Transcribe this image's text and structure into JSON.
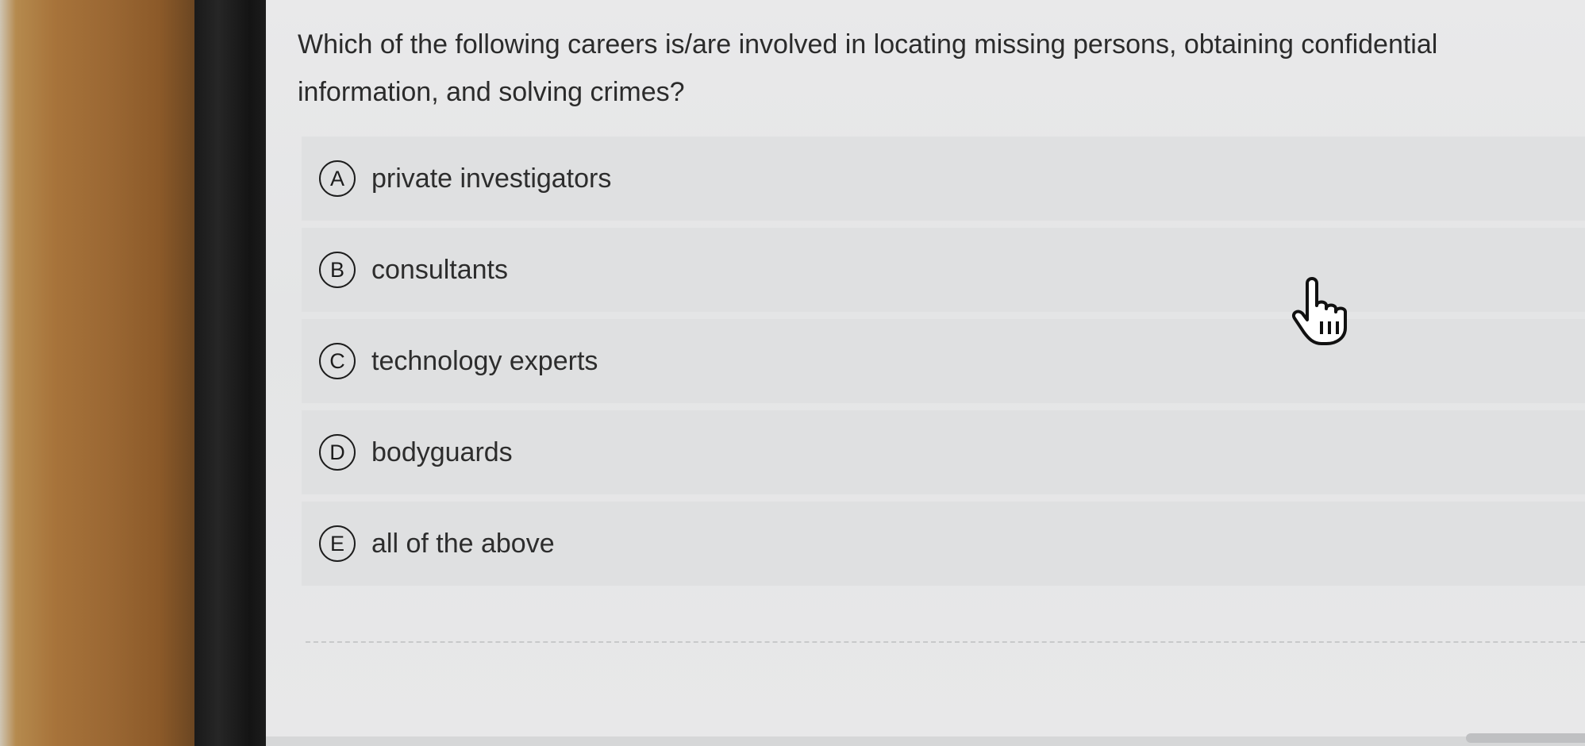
{
  "question": {
    "text": "Which of the following careers is/are involved in locating missing persons, obtaining confidential information, and solving crimes?"
  },
  "options": [
    {
      "letter": "A",
      "label": "private investigators"
    },
    {
      "letter": "B",
      "label": "consultants"
    },
    {
      "letter": "C",
      "label": "technology experts"
    },
    {
      "letter": "D",
      "label": "bodyguards"
    },
    {
      "letter": "E",
      "label": "all of the above"
    }
  ],
  "cursor": {
    "icon": "hand-pointer-icon"
  }
}
